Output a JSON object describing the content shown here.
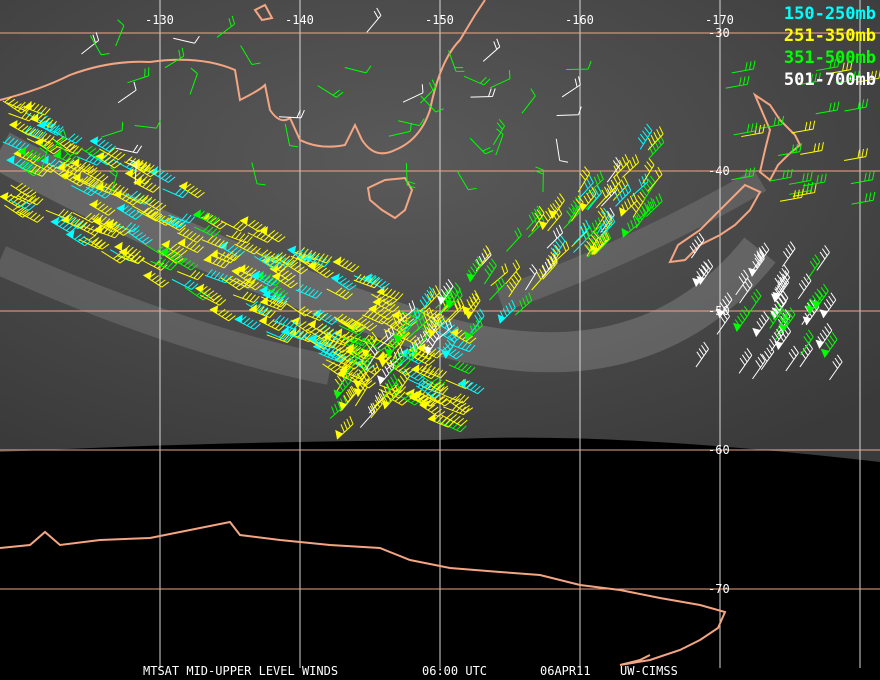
{
  "title": "MTSAT MID-UPPER LEVEL WINDS",
  "time": "06:00 UTC",
  "date": "06APR11",
  "source": "UW-CIMSS",
  "longitude_labels": [
    "-130",
    "-140",
    "-150",
    "-160",
    "-170"
  ],
  "latitude_labels": [
    "-30",
    "-40",
    "-50",
    "-60",
    "-70"
  ],
  "legend": [
    {
      "label": "150-250mb",
      "color": "#00ffff"
    },
    {
      "label": "251-350mb",
      "color": "#ffff00"
    },
    {
      "label": "351-500mb",
      "color": "#00ff00"
    },
    {
      "label": "501-700mb",
      "color": "#ffffff"
    }
  ],
  "colors": {
    "coast": "#f4a582",
    "lat_grid": "#f4a582",
    "lon_grid": "#d8d8d8"
  }
}
